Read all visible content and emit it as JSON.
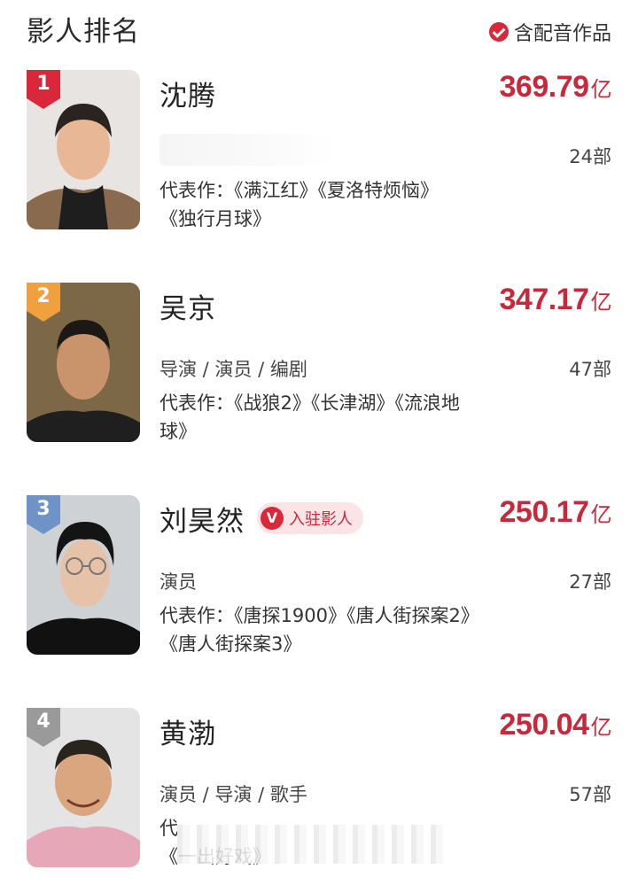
{
  "header": {
    "title": "影人排名",
    "dub_toggle_label": "含配音作品"
  },
  "colors": {
    "accent_red": "#c8283a",
    "badge_red": "#d8283a",
    "badge_orange": "#f0a03c",
    "badge_blue": "#6f93c7",
    "badge_gray": "#9a9a9a"
  },
  "rankings": [
    {
      "rank": "1",
      "name": "沈腾",
      "box_office": "369.79",
      "unit": "亿",
      "roles": "",
      "count": "24部",
      "works_line1": "代表作：《满江红》《夏洛特烦恼》",
      "works_line2": "《独行月球》"
    },
    {
      "rank": "2",
      "name": "吴京",
      "box_office": "347.17",
      "unit": "亿",
      "roles": "导演 / 演员 / 编剧",
      "count": "47部",
      "works_line1": "代表作：《战狼2》《长津湖》《流浪地",
      "works_line2": "球》"
    },
    {
      "rank": "3",
      "name": "刘昊然",
      "badge_label": "入驻影人",
      "badge_icon": "V",
      "box_office": "250.17",
      "unit": "亿",
      "roles": "演员",
      "count": "27部",
      "works_line1": "代表作：《唐探1900》《唐人街探案2》",
      "works_line2": "《唐人街探案3》"
    },
    {
      "rank": "4",
      "name": "黄渤",
      "box_office": "250.04",
      "unit": "亿",
      "roles": "演员 / 导演 / 歌手",
      "count": "57部",
      "works_line1": "代",
      "works_line2": "《一出好戏》"
    }
  ]
}
